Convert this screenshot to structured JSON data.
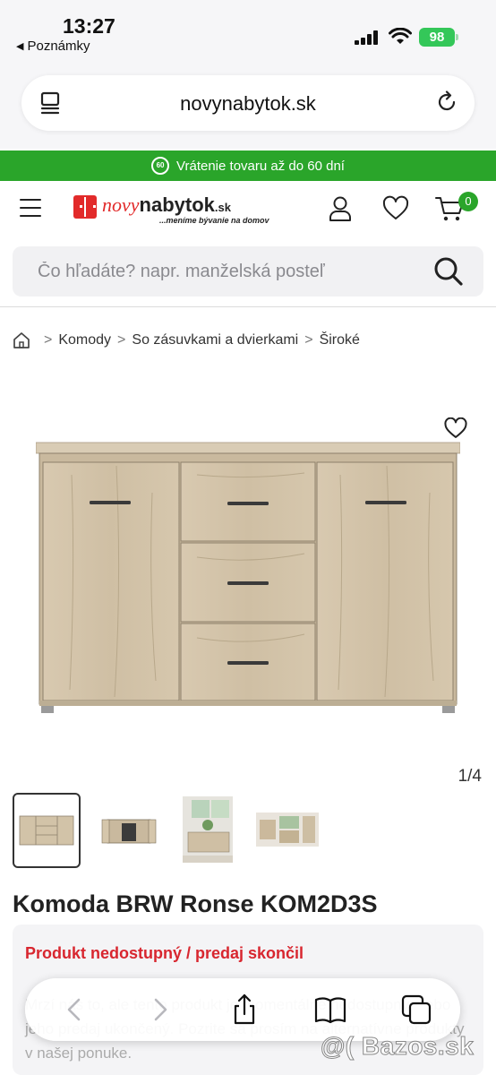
{
  "status_bar": {
    "time": "13:27",
    "back_app": "Poznámky",
    "battery": "98"
  },
  "browser": {
    "url": "novynabytok.sk"
  },
  "promo": {
    "badge": "60",
    "text": "Vrátenie tovaru až do 60 dní",
    "color": "#2aa52a"
  },
  "header": {
    "logo_part1": "novy",
    "logo_part2": "nabytok",
    "logo_tld": ".sk",
    "logo_tagline": "...meníme bývanie na domov",
    "cart_count": "0",
    "brand_red": "#e22a2a"
  },
  "search": {
    "placeholder": "Čo hľadáte? napr. manželská posteľ"
  },
  "breadcrumb": {
    "items": [
      "Komody",
      "So zásuvkami a dvierkami",
      "Široké"
    ],
    "separator": ">"
  },
  "gallery": {
    "counter": "1/4",
    "thumb_count": 4
  },
  "product": {
    "title": "Komoda BRW Ronse KOM2D3S",
    "availability": "Produkt nedostupný / predaj skončil",
    "availability_note": "Mrzí nás to, ale tento produkt je momentálne nedostupný alebo jeho predaj ukončený. Pozrite sa prosím na alternatívne produkty v našej ponuke."
  },
  "watermark": "@( Bazos.sk"
}
